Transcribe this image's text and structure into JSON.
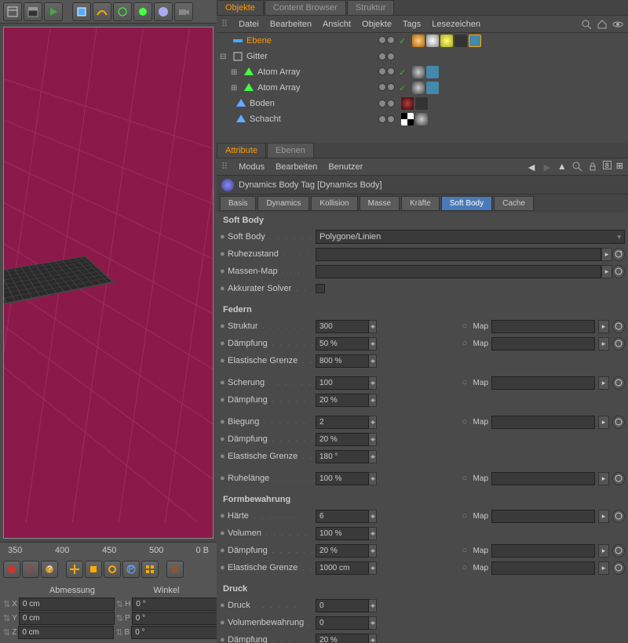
{
  "tabs_top": {
    "objekte": "Objekte",
    "content_browser": "Content Browser",
    "struktur": "Struktur"
  },
  "obj_menu": {
    "datei": "Datei",
    "bearbeiten": "Bearbeiten",
    "ansicht": "Ansicht",
    "objekte": "Objekte",
    "tags": "Tags",
    "lesezeichen": "Lesezeichen"
  },
  "tree": {
    "ebene": "Ebene",
    "gitter": "Gitter",
    "atom1": "Atom Array",
    "atom2": "Atom Array",
    "boden": "Boden",
    "schacht": "Schacht"
  },
  "attr_tabs": {
    "attribute": "Attribute",
    "ebenen": "Ebenen"
  },
  "attr_menu": {
    "modus": "Modus",
    "bearbeiten": "Bearbeiten",
    "benutzer": "Benutzer"
  },
  "tag_name": "Dynamics Body Tag [Dynamics Body]",
  "subtabs": {
    "basis": "Basis",
    "dynamics": "Dynamics",
    "kollision": "Kollision",
    "masse": "Masse",
    "kraefte": "Kräfte",
    "softbody": "Soft Body",
    "cache": "Cache"
  },
  "sections": {
    "softbody": "Soft Body",
    "federn": "Federn",
    "formbewahrung": "Formbewahrung",
    "druck": "Druck"
  },
  "labels": {
    "softbody": "Soft Body",
    "ruhezustand": "Ruhezustand",
    "massenmap": "Massen-Map",
    "akkurater": "Akkurater Solver",
    "struktur": "Struktur",
    "daempfung": "Dämpfung",
    "elastische": "Elastische Grenze",
    "scherung": "Scherung",
    "biegung": "Biegung",
    "ruhelaenge": "Ruhelänge",
    "haerte": "Härte",
    "volumen": "Volumen",
    "druck": "Druck",
    "volumenbewahrung": "Volumenbewahrung",
    "map": "Map"
  },
  "values": {
    "softbody_mode": "Polygone/Linien",
    "struktur": "300",
    "struktur_d": "50 %",
    "struktur_e": "800 %",
    "scherung": "100",
    "scherung_d": "20 %",
    "biegung": "2",
    "biegung_d": "20 %",
    "biegung_e": "180 °",
    "ruhelaenge": "100 %",
    "haerte": "6",
    "volumen": "100 %",
    "form_d": "20 %",
    "form_e": "1000 cm",
    "druck": "0",
    "volbew": "0",
    "druck_d": "20 %"
  },
  "ruler": {
    "t350": "350",
    "t400": "400",
    "t450": "450",
    "t500": "500",
    "ob": "0 B"
  },
  "coords": {
    "hdr_abm": "Abmessung",
    "hdr_wnk": "Winkel",
    "x": "X",
    "y": "Y",
    "z": "Z",
    "h": "H",
    "p": "P",
    "b": "B",
    "cm": "0 cm",
    "deg": "0 °"
  }
}
